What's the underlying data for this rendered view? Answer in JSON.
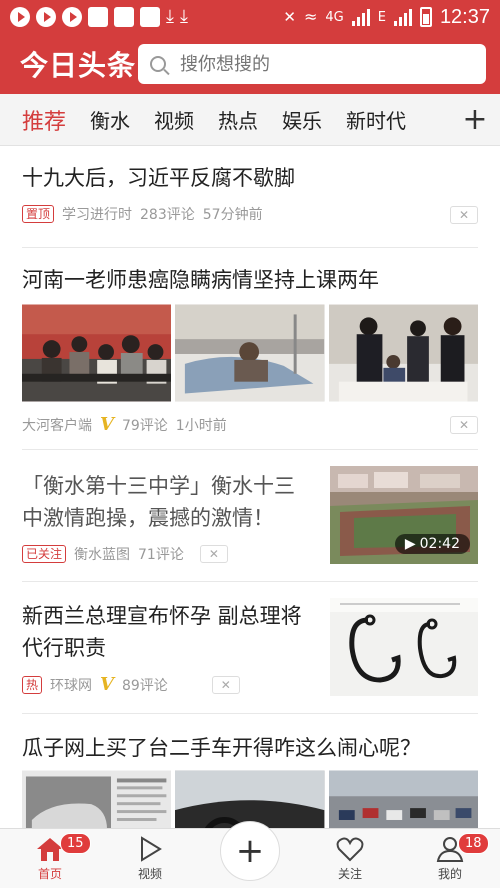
{
  "status_bar": {
    "network": "4G",
    "carrier": "E",
    "time": "12:37"
  },
  "header": {
    "logo": "今日头条",
    "search_placeholder": "搜你想搜的"
  },
  "tabs": [
    "推荐",
    "衡水",
    "视频",
    "热点",
    "娱乐",
    "新时代"
  ],
  "feed": [
    {
      "title": "十九大后，习近平反腐不歇脚",
      "tag": "置顶",
      "source": "学习进行时",
      "comments": "283评论",
      "time": "57分钟前"
    },
    {
      "title": "河南一老师患癌隐瞒病情坚持上课两年",
      "source": "大河客户端",
      "verified": "V",
      "comments": "79评论",
      "time": "1小时前"
    },
    {
      "title": "「衡水第十三中学」衡水十三中激情跑操，震撼的激情！",
      "tag": "已关注",
      "source": "衡水蓝图",
      "comments": "71评论",
      "duration": "02:42"
    },
    {
      "title": "新西兰总理宣布怀孕 副总理将代行职责",
      "tag": "热",
      "source": "环球网",
      "verified": "V",
      "comments": "89评论"
    },
    {
      "title": "瓜子网上买了台二手车开得咋这么闹心呢？"
    }
  ],
  "bottom_nav": [
    {
      "label": "首页",
      "badge": "15"
    },
    {
      "label": "视频"
    },
    {
      "label": ""
    },
    {
      "label": "关注"
    },
    {
      "label": "我的",
      "badge": "18"
    }
  ],
  "colors": {
    "brand_red": "#d43d3d",
    "verified_gold": "#e6b422"
  }
}
